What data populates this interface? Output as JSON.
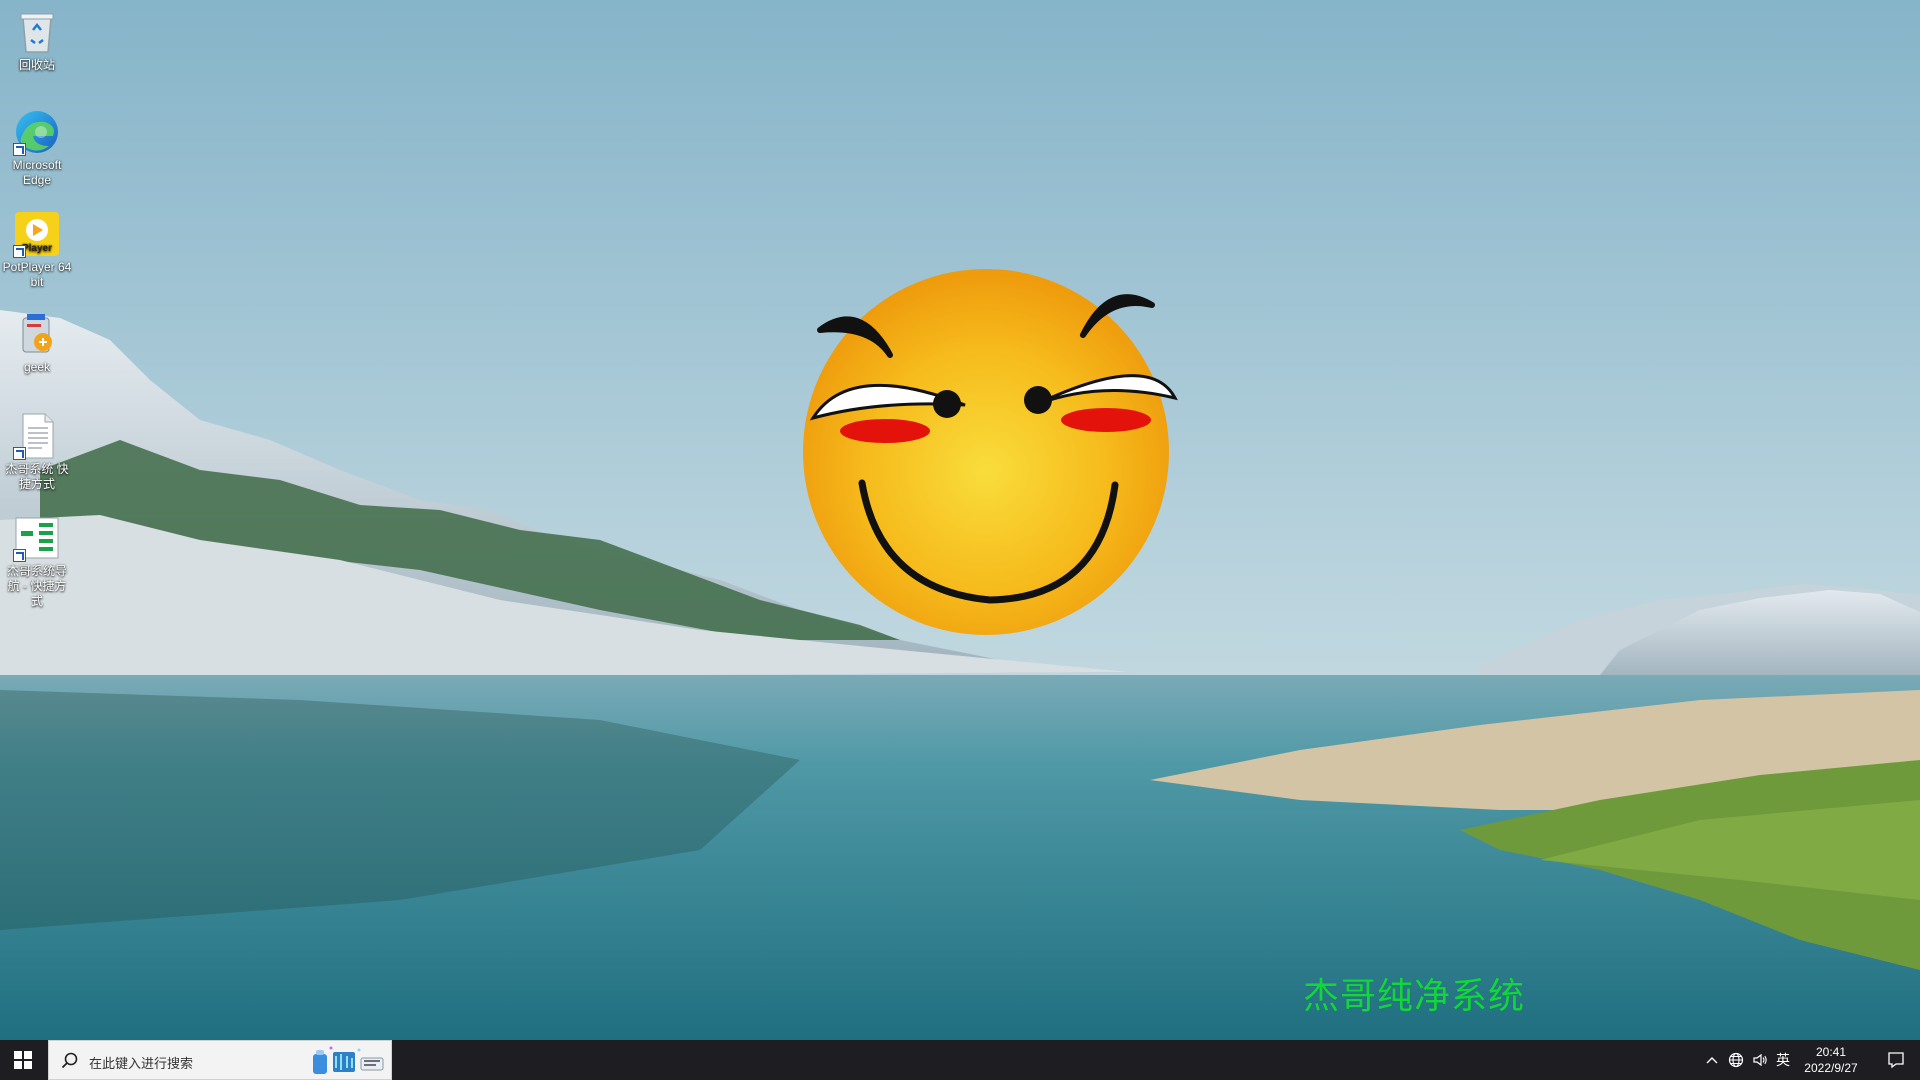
{
  "desktop": {
    "icons": [
      {
        "label": "回收站",
        "icon": "recycle-bin-icon"
      },
      {
        "label": "Microsoft Edge",
        "icon": "edge-icon"
      },
      {
        "label": "PotPlayer 64 bit",
        "icon": "potplayer-icon"
      },
      {
        "label": "geek",
        "icon": "geek-uninstaller-icon"
      },
      {
        "label": "杰哥系统 快捷方式",
        "icon": "document-shortcut-icon"
      },
      {
        "label": "杰哥系统导航 - 快捷方式",
        "icon": "navigation-shortcut-icon"
      }
    ],
    "watermark": "杰哥纯净系统",
    "potplayer_badge": "Player"
  },
  "taskbar": {
    "search_placeholder": "在此键入进行搜索",
    "ime_label": "英",
    "time": "20:41",
    "date": "2022/9/27"
  },
  "colors": {
    "taskbar_bg": "#1e1e22",
    "watermark": "#13d63c",
    "smiley_face": "#f5a716"
  }
}
